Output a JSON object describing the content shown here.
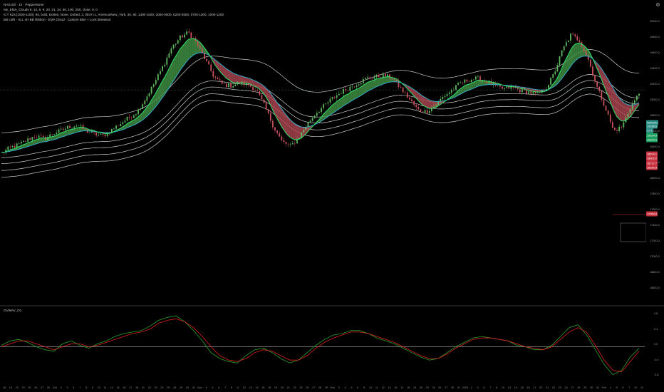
{
  "legend": {
    "line1": "NAS100 · 1h · Pepperstone",
    "line2": "My_EMA_Clouds 8, 14, 8, 9, 20, 21, 34, 50, 100, 200, close, 0, 0",
    "line3": "ICT KZs [1000-1100], 60, bold, Dotted, None, Dotted, 2, 0847=1, America/New_York, 30, 90, 1400-1500, 2000-0000, 0200-0500, 0700-1000, 1000-1200",
    "line4": "BB LBR · ALL 4H BB Ribbon · EMA Cloud · Custom BBA + Lock Breakout"
  },
  "gear_icon": "gear-icon",
  "indicator_label": "GVWAV_O1",
  "price_ticks": [
    "20000.0",
    "19800.0",
    "19600.0",
    "19400.0",
    "19200.0",
    "19000.0",
    "18800.0",
    "18600.0",
    "18400.0",
    "18200.0",
    "18000.0",
    "17800.0",
    "17600.0",
    "17400.0",
    "17200.0",
    "17000.0",
    "16800.0",
    "16600.0"
  ],
  "tags": [
    {
      "text": "NAS100",
      "style": "teal"
    },
    {
      "text": "19186.6",
      "style": "teal"
    },
    {
      "text": "17.7",
      "style": "teal"
    },
    {
      "text": "19164.9",
      "style": "green"
    },
    {
      "text": "19024.0",
      "style": "green"
    },
    {
      "text": "18874.1",
      "style": "red"
    },
    {
      "text": "18802.9",
      "style": "red"
    },
    {
      "text": "18717.7",
      "style": "red"
    },
    {
      "text": "18616.8",
      "style": "red"
    },
    {
      "text": "17954.5",
      "style": "red"
    }
  ],
  "indicator_ticks": [
    "0.8",
    "0.4",
    "0.0",
    "-0.4",
    "-0.8"
  ],
  "time_labels": [
    "18",
    "19",
    "23",
    "24",
    "25",
    "26",
    "27",
    "30",
    "Oct",
    "2",
    "3",
    "4",
    "7",
    "8",
    "9",
    "10",
    "11",
    "14",
    "15",
    "16",
    "17",
    "18",
    "21",
    "22",
    "23",
    "24",
    "25",
    "28",
    "29",
    "30",
    "31",
    "Nov",
    "4",
    "5",
    "6",
    "7",
    "8",
    "11",
    "12",
    "13",
    "14",
    "15",
    "18",
    "19",
    "20",
    "21",
    "22",
    "25",
    "26",
    "27",
    "28",
    "29",
    "Dec",
    "3",
    "4",
    "5",
    "6",
    "9",
    "10",
    "11",
    "12",
    "13",
    "16",
    "17",
    "18",
    "19",
    "20",
    "23",
    "24",
    "26",
    "27",
    "30",
    "31",
    "2025",
    "2",
    "3",
    "6",
    "7",
    "8",
    "10",
    "13",
    "14",
    "15",
    "16",
    "17",
    "20",
    "21",
    "22",
    "23",
    "24",
    "27",
    "28",
    "29",
    "30",
    "31",
    "Feb",
    "4",
    "5",
    "6",
    "7",
    "10",
    "11"
  ],
  "colors": {
    "bull": "#5fb85f",
    "bear": "#c8505a",
    "cloud_green": "#3f8f43",
    "cloud_red": "#a94450",
    "fast_ema": "#2fe06a",
    "slow_ema": "#35a7c4",
    "ribbon": "#f0f0f0",
    "osc_green": "#2aa02a",
    "osc_red": "#e02020"
  },
  "chart_data": [
    {
      "type": "line",
      "title": "NAS100 · 1h · Pepperstone",
      "series": [
        {
          "name": "Price",
          "values": [
            18350,
            18420,
            18460,
            18520,
            18580,
            18540,
            18600,
            18650,
            18700,
            18720,
            18640,
            18600,
            18580,
            18660,
            18740,
            18820,
            18900,
            19080,
            19280,
            19500,
            19740,
            19880,
            19950,
            19800,
            19580,
            19360,
            19260,
            19240,
            19280,
            19260,
            19180,
            18960,
            18700,
            18500,
            18440,
            18560,
            18740,
            18880,
            18980,
            19080,
            19160,
            19220,
            19280,
            19340,
            19360,
            19380,
            19340,
            19200,
            19060,
            18920,
            18900,
            18980,
            19100,
            19180,
            19280,
            19320,
            19340,
            19300,
            19240,
            19200,
            19220,
            19180,
            19160,
            19120,
            19200,
            19400,
            19720,
            19920,
            19840,
            19600,
            19240,
            18960,
            18640,
            18700,
            18960,
            19140
          ]
        }
      ],
      "ylim": [
        16600,
        20000
      ]
    },
    {
      "type": "line",
      "title": "GVWAV_O1",
      "series": [
        {
          "name": "",
          "values": [
            0.05,
            0.2,
            0.25,
            0.15,
            0.0,
            -0.1,
            -0.15,
            0.1,
            0.2,
            0.05,
            -0.05,
            0.1,
            0.2,
            0.35,
            0.45,
            0.5,
            0.55,
            0.7,
            0.9,
            1.0,
            1.05,
            0.85,
            0.55,
            0.2,
            -0.2,
            -0.4,
            -0.5,
            -0.55,
            -0.3,
            -0.1,
            -0.05,
            -0.2,
            -0.4,
            -0.55,
            -0.45,
            -0.2,
            0.05,
            0.25,
            0.4,
            0.45,
            0.55,
            0.55,
            0.45,
            0.3,
            0.2,
            0.1,
            -0.05,
            -0.2,
            -0.35,
            -0.45,
            -0.4,
            -0.2,
            0.0,
            0.15,
            0.3,
            0.35,
            0.3,
            0.25,
            0.2,
            0.05,
            0.0,
            -0.1,
            -0.1,
            0.05,
            0.35,
            0.65,
            0.75,
            0.4,
            -0.1,
            -0.6,
            -0.95,
            -0.8,
            -0.35,
            -0.05
          ]
        },
        {
          "name": "",
          "values": [
            0.0,
            0.1,
            0.2,
            0.2,
            0.1,
            0.0,
            -0.1,
            0.0,
            0.1,
            0.1,
            0.0,
            0.05,
            0.15,
            0.25,
            0.35,
            0.45,
            0.5,
            0.6,
            0.8,
            0.9,
            0.95,
            0.85,
            0.65,
            0.35,
            0.0,
            -0.3,
            -0.45,
            -0.5,
            -0.4,
            -0.2,
            -0.1,
            -0.15,
            -0.3,
            -0.45,
            -0.45,
            -0.3,
            -0.05,
            0.15,
            0.3,
            0.4,
            0.5,
            0.5,
            0.45,
            0.35,
            0.25,
            0.15,
            0.0,
            -0.15,
            -0.3,
            -0.4,
            -0.4,
            -0.25,
            -0.05,
            0.1,
            0.25,
            0.3,
            0.3,
            0.25,
            0.2,
            0.1,
            0.0,
            -0.05,
            -0.1,
            0.0,
            0.25,
            0.5,
            0.65,
            0.5,
            0.05,
            -0.45,
            -0.8,
            -0.85,
            -0.5,
            -0.15
          ]
        }
      ],
      "ylim": [
        -1.1,
        1.2
      ]
    }
  ]
}
